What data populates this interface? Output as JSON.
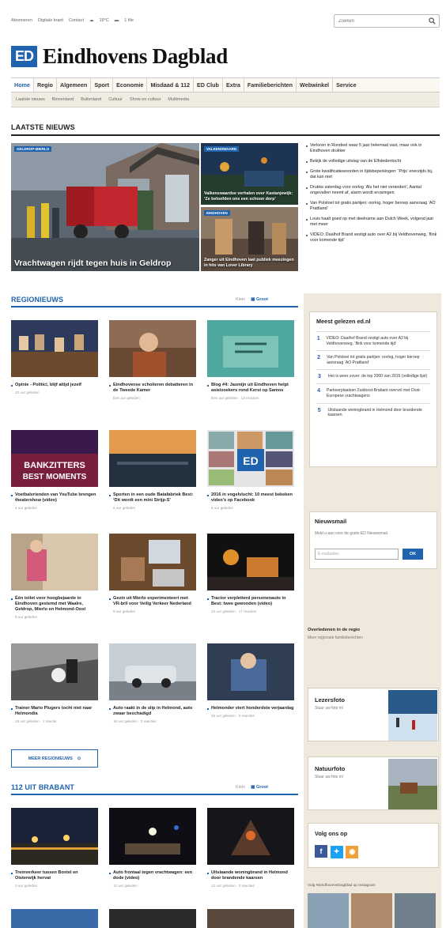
{
  "topbar": {
    "links": [
      "Abonneren",
      "Digitale krant",
      "Contact"
    ],
    "weather": "19°C",
    "traffic": "1 file",
    "search_placeholder": "Zoeken"
  },
  "logo": {
    "mark": "ED",
    "name": "Eindhovens Dagblad"
  },
  "nav": {
    "main": [
      "Home",
      "Regio",
      "Algemeen",
      "Sport",
      "Economie",
      "Misdaad & 112",
      "ED Club",
      "Extra",
      "Familieberichten",
      "Webwinkel",
      "Service"
    ],
    "sub": [
      "Laatste nieuws",
      "Binnenland",
      "Buitenland",
      "Cultuur",
      "Show en cultuur",
      "Multimedia"
    ]
  },
  "latest": {
    "title": "LAATSTE NIEUWS",
    "hero": {
      "tag": "GELDROP-MIERLO",
      "title": "Vrachtwagen rijdt tegen huis in Geldrop"
    },
    "side": [
      {
        "tag": "VALKENSWAARD",
        "title": "Valkenswaardse verhalen over Kastanjewijk: ‘Ze beloofden ons een schoon dorp’"
      },
      {
        "tag": "EINDHOVEN",
        "title": "Zanger uit Eindhoven laat publiek meezingen in hits van Lover Library"
      }
    ],
    "list": [
      "Verloren in Rondeel waar 5 jaar helemaal vast, maar ook in Eindhoven drukker",
      "Bekijk de volledige uitslag van de Elfstedentocht",
      "Grote kwalificatiewoorden in tijdsbeperkingen: ‘Prijs’ enerzijds bij, dat kan niet",
      "Drukke zaterdag voor oorlog ‘Als het niet verandert’, Aantal ongevallen neemt af, alarm wordt ervaringen",
      "Van Polstoel tot gratis partijen: oorlog, hoger beroep aanvraag ‘AO Prattland’",
      "Louis haalt goed op met deelname aan Dutch Week, volgend jaar met meer",
      "VIDEO: Daalhof Brand vestigt auto over A2 bij Veldhovenweg, ‘flink voor komende tijd’"
    ]
  },
  "regio": {
    "title": "REGIONIEUWS",
    "toggle": [
      "Klein",
      "Groot"
    ],
    "cards": [
      {
        "title": "Opinie - Politici, blijf altijd jezelf",
        "meta": "10 uur geleden"
      },
      {
        "title": "Eindhovense scholieren debatteren in de Tweede Kamer",
        "meta": "Een uur geleden"
      },
      {
        "title": "Blog #4: Jasmijn uit Eindhoven helpt asielzoekers rond Kerst op Samos",
        "meta": "Een uur geleden · 13 reacties"
      },
      {
        "title": "Voetbalvrienden van YouTube brengen theatershow (video)",
        "meta": "4 uur geleden"
      },
      {
        "title": "Sporten in een oude Batafabriek Best: ‘Dit wordt een mini Strijp-S’",
        "meta": "6 uur geleden"
      },
      {
        "title": "2016 in vogelvlucht: 10 meest bekeken video’s op Facebook",
        "meta": "6 uur geleden"
      },
      {
        "title": "Één toilet voor hoogbejaarde in Eindhoven gestemd met Waalre, Geldrop, Mierlo en Helmond-Oost",
        "meta": "8 uur geleden"
      },
      {
        "title": "Gezin uit Mierlo experimenteert met VR-bril voor Veilig Verkeer Nederland",
        "meta": "9 uur geleden"
      },
      {
        "title": "Tractor verpletterd personenauto in Best: twee gewonden (video)",
        "meta": "10 uur geleden · 17 reacties"
      },
      {
        "title": "Trainer Mario Plugers tocht niet naar Helmondia",
        "meta": "15 uur geleden · 1 reactie"
      },
      {
        "title": "Auto raakt in de slip in Helmond, auto zwaar beschadigd",
        "meta": "16 uur geleden · 3 reacties"
      },
      {
        "title": "Helmonder viert honderdste verjaardag",
        "meta": "16 uur geleden · 3 reacties"
      }
    ],
    "more": "MEER REGIONIEUWS"
  },
  "brabant": {
    "title": "112 UIT BRABANT",
    "toggle": [
      "Klein",
      "Groot"
    ],
    "cards": [
      {
        "title": "Treinverkeer tussen Boxtel en Oisterwijk hervat",
        "meta": "3 uur geleden"
      },
      {
        "title": "Auto frontaal tegen vrachtwagen: een dode (video)",
        "meta": "12 uur geleden"
      },
      {
        "title": "Uitslaande woningbrand in Helmond door brandende kaarsen",
        "meta": "12 uur geleden · 3 reacties"
      }
    ]
  },
  "sidebar": {
    "most_read": {
      "title": "Meest gelezen ed.nl",
      "items": [
        "VIDEO: Daalhof Brand vestigt auto over A2 bij Veldhovenweg, ‘flink voor komende tijd’",
        "Van Polstoel tot gratis partijen: oorlog, hoger beroep aanvraag ‘AO Prattland’",
        "Het is weer zover: de top 2000 van 2016 (volledige lijst)",
        "Parkeerplaatsen Zuidoost-Brabant overvol met Oost-Europese vrachtwagens",
        "Uitslaande woningbrand in Helmond door brandende kaarsen"
      ]
    },
    "newsletter": {
      "title": "Nieuwsmail",
      "text": "Meld u aan voor de gratis ED Nieuwsmail.",
      "placeholder": "E-mailadres",
      "button": "OK"
    },
    "deceased": {
      "title": "Overledenen in de regio",
      "sub": "Meer regionale familieberichten"
    },
    "lezersfoto": {
      "title": "Lezersfoto",
      "sub": "Stuur uw foto in!"
    },
    "natuurfoto": {
      "title": "Natuurfoto",
      "sub": "Stuur uw foto in!"
    },
    "follow": {
      "title": "Volg ons op",
      "social": [
        "f",
        "t",
        "rss"
      ]
    },
    "instagram": "Volg #EindhovensDagblad op Instagram"
  },
  "colors": {
    "brand": "#1f62ad",
    "sidebar_bg": "#efe9dd"
  }
}
